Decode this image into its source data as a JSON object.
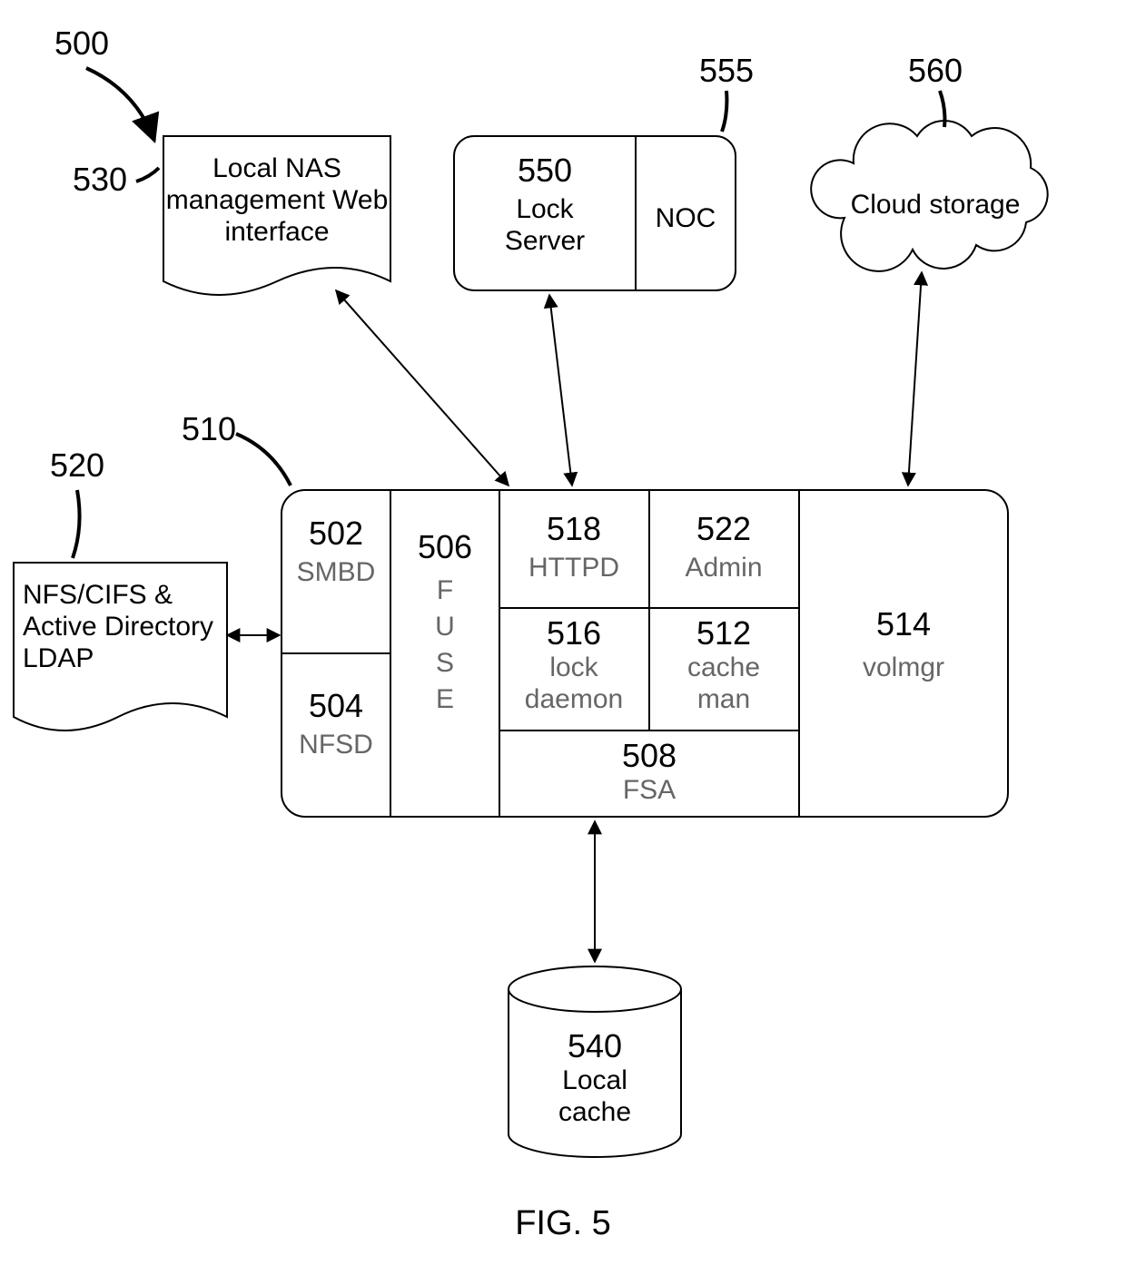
{
  "figure": {
    "caption": "FIG. 5",
    "labels": {
      "l500": "500",
      "l510": "510",
      "l520": "520",
      "l530": "530",
      "l555": "555",
      "l560": "560"
    }
  },
  "nodes": {
    "nas": {
      "line1": "Local NAS",
      "line2": "management Web",
      "line3": "interface"
    },
    "noc": {
      "lockserver_id": "550",
      "lockserver_l1": "Lock",
      "lockserver_l2": "Server",
      "noc_label": "NOC"
    },
    "cloud": {
      "label": "Cloud storage"
    },
    "nfs": {
      "l1": "NFS/CIFS &",
      "l2": "Active Directory",
      "l3": "LDAP"
    },
    "cache": {
      "id": "540",
      "l1": "Local",
      "l2": "cache"
    }
  },
  "core": {
    "b502": {
      "id": "502",
      "lbl": "SMBD"
    },
    "b504": {
      "id": "504",
      "lbl": "NFSD"
    },
    "b506": {
      "id": "506",
      "lbl": "F\nU\nS\nE"
    },
    "b506id": "506",
    "b506c1": "F",
    "b506c2": "U",
    "b506c3": "S",
    "b506c4": "E",
    "b518": {
      "id": "518",
      "lbl": "HTTPD"
    },
    "b522": {
      "id": "522",
      "lbl": "Admin"
    },
    "b516": {
      "id": "516",
      "l1": "lock",
      "l2": "daemon"
    },
    "b512": {
      "id": "512",
      "l1": "cache",
      "l2": "man"
    },
    "b508": {
      "id": "508",
      "lbl": "FSA"
    },
    "b514": {
      "id": "514",
      "lbl": "volmgr"
    }
  }
}
